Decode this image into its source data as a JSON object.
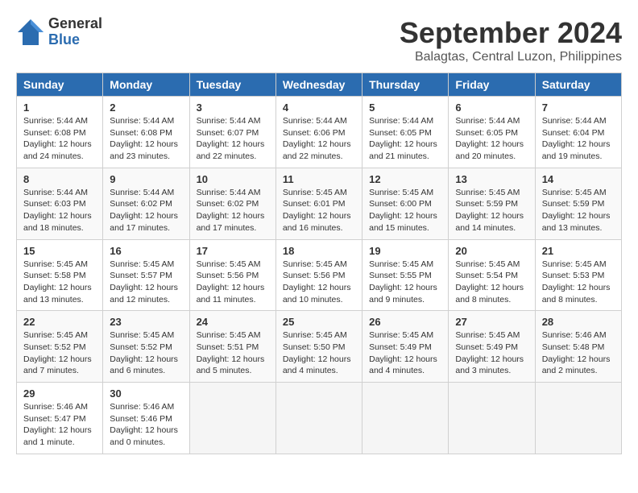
{
  "header": {
    "logo_general": "General",
    "logo_blue": "Blue",
    "month_title": "September 2024",
    "location": "Balagtas, Central Luzon, Philippines"
  },
  "weekdays": [
    "Sunday",
    "Monday",
    "Tuesday",
    "Wednesday",
    "Thursday",
    "Friday",
    "Saturday"
  ],
  "weeks": [
    [
      {
        "day": "1",
        "info": "Sunrise: 5:44 AM\nSunset: 6:08 PM\nDaylight: 12 hours\nand 24 minutes."
      },
      {
        "day": "2",
        "info": "Sunrise: 5:44 AM\nSunset: 6:08 PM\nDaylight: 12 hours\nand 23 minutes."
      },
      {
        "day": "3",
        "info": "Sunrise: 5:44 AM\nSunset: 6:07 PM\nDaylight: 12 hours\nand 22 minutes."
      },
      {
        "day": "4",
        "info": "Sunrise: 5:44 AM\nSunset: 6:06 PM\nDaylight: 12 hours\nand 22 minutes."
      },
      {
        "day": "5",
        "info": "Sunrise: 5:44 AM\nSunset: 6:05 PM\nDaylight: 12 hours\nand 21 minutes."
      },
      {
        "day": "6",
        "info": "Sunrise: 5:44 AM\nSunset: 6:05 PM\nDaylight: 12 hours\nand 20 minutes."
      },
      {
        "day": "7",
        "info": "Sunrise: 5:44 AM\nSunset: 6:04 PM\nDaylight: 12 hours\nand 19 minutes."
      }
    ],
    [
      {
        "day": "8",
        "info": "Sunrise: 5:44 AM\nSunset: 6:03 PM\nDaylight: 12 hours\nand 18 minutes."
      },
      {
        "day": "9",
        "info": "Sunrise: 5:44 AM\nSunset: 6:02 PM\nDaylight: 12 hours\nand 17 minutes."
      },
      {
        "day": "10",
        "info": "Sunrise: 5:44 AM\nSunset: 6:02 PM\nDaylight: 12 hours\nand 17 minutes."
      },
      {
        "day": "11",
        "info": "Sunrise: 5:45 AM\nSunset: 6:01 PM\nDaylight: 12 hours\nand 16 minutes."
      },
      {
        "day": "12",
        "info": "Sunrise: 5:45 AM\nSunset: 6:00 PM\nDaylight: 12 hours\nand 15 minutes."
      },
      {
        "day": "13",
        "info": "Sunrise: 5:45 AM\nSunset: 5:59 PM\nDaylight: 12 hours\nand 14 minutes."
      },
      {
        "day": "14",
        "info": "Sunrise: 5:45 AM\nSunset: 5:59 PM\nDaylight: 12 hours\nand 13 minutes."
      }
    ],
    [
      {
        "day": "15",
        "info": "Sunrise: 5:45 AM\nSunset: 5:58 PM\nDaylight: 12 hours\nand 13 minutes."
      },
      {
        "day": "16",
        "info": "Sunrise: 5:45 AM\nSunset: 5:57 PM\nDaylight: 12 hours\nand 12 minutes."
      },
      {
        "day": "17",
        "info": "Sunrise: 5:45 AM\nSunset: 5:56 PM\nDaylight: 12 hours\nand 11 minutes."
      },
      {
        "day": "18",
        "info": "Sunrise: 5:45 AM\nSunset: 5:56 PM\nDaylight: 12 hours\nand 10 minutes."
      },
      {
        "day": "19",
        "info": "Sunrise: 5:45 AM\nSunset: 5:55 PM\nDaylight: 12 hours\nand 9 minutes."
      },
      {
        "day": "20",
        "info": "Sunrise: 5:45 AM\nSunset: 5:54 PM\nDaylight: 12 hours\nand 8 minutes."
      },
      {
        "day": "21",
        "info": "Sunrise: 5:45 AM\nSunset: 5:53 PM\nDaylight: 12 hours\nand 8 minutes."
      }
    ],
    [
      {
        "day": "22",
        "info": "Sunrise: 5:45 AM\nSunset: 5:52 PM\nDaylight: 12 hours\nand 7 minutes."
      },
      {
        "day": "23",
        "info": "Sunrise: 5:45 AM\nSunset: 5:52 PM\nDaylight: 12 hours\nand 6 minutes."
      },
      {
        "day": "24",
        "info": "Sunrise: 5:45 AM\nSunset: 5:51 PM\nDaylight: 12 hours\nand 5 minutes."
      },
      {
        "day": "25",
        "info": "Sunrise: 5:45 AM\nSunset: 5:50 PM\nDaylight: 12 hours\nand 4 minutes."
      },
      {
        "day": "26",
        "info": "Sunrise: 5:45 AM\nSunset: 5:49 PM\nDaylight: 12 hours\nand 4 minutes."
      },
      {
        "day": "27",
        "info": "Sunrise: 5:45 AM\nSunset: 5:49 PM\nDaylight: 12 hours\nand 3 minutes."
      },
      {
        "day": "28",
        "info": "Sunrise: 5:46 AM\nSunset: 5:48 PM\nDaylight: 12 hours\nand 2 minutes."
      }
    ],
    [
      {
        "day": "29",
        "info": "Sunrise: 5:46 AM\nSunset: 5:47 PM\nDaylight: 12 hours\nand 1 minute."
      },
      {
        "day": "30",
        "info": "Sunrise: 5:46 AM\nSunset: 5:46 PM\nDaylight: 12 hours\nand 0 minutes."
      },
      null,
      null,
      null,
      null,
      null
    ]
  ]
}
